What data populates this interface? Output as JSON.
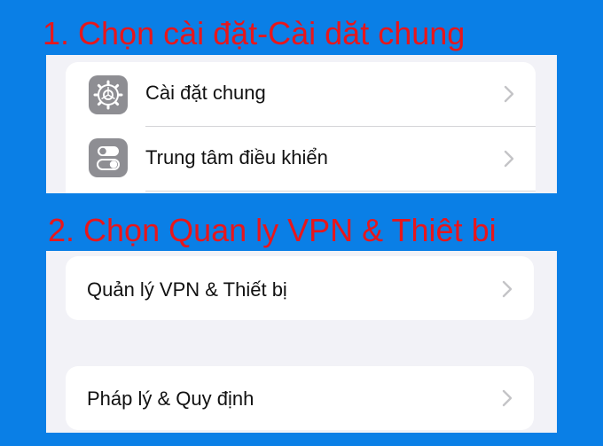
{
  "steps": {
    "step1_title": "1. Chọn cài đặt-Cài dăt chung",
    "step2_title": "2. Chọn Quan ly VPN & Thiêt bi"
  },
  "panel1": {
    "rows": [
      {
        "label": "Cài đặt chung",
        "icon": "gear-icon"
      },
      {
        "label": "Trung tâm điều khiển",
        "icon": "toggle-switches-icon"
      }
    ]
  },
  "panel2": {
    "rows": [
      {
        "label": "Quản lý VPN & Thiết bị"
      },
      {
        "label": "Pháp lý & Quy định"
      }
    ]
  },
  "colors": {
    "background": "#0a7fe6",
    "annotation_text": "#e8161b",
    "icon_gray": "#8e8e93",
    "chevron": "#c4c4c7"
  }
}
